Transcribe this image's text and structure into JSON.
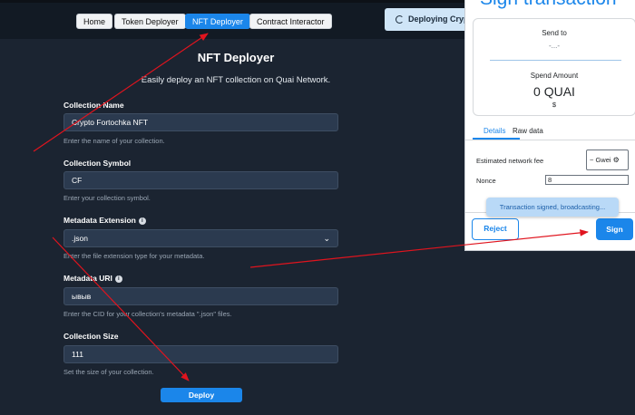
{
  "nav": {
    "home": "Home",
    "token_deployer": "Token Deployer",
    "nft_deployer": "NFT Deployer",
    "contract_interactor": "Contract Interactor",
    "deploying": "Deploying Crypt"
  },
  "page": {
    "title": "NFT Deployer",
    "subtitle": "Easily deploy an NFT collection on Quai Network."
  },
  "form": {
    "collection_name": {
      "label": "Collection Name",
      "value": "Crypto Fortochka NFT",
      "help": "Enter the name of your collection."
    },
    "collection_symbol": {
      "label": "Collection Symbol",
      "value": "CF",
      "help": "Enter your collection symbol."
    },
    "metadata_extension": {
      "label": "Metadata Extension",
      "value": ".json",
      "help": "Enter the file extension type for your metadata."
    },
    "metadata_uri": {
      "label": "Metadata URI",
      "value": "ывыв",
      "help": "Enter the CID for your collection's metadata \".json\" files."
    },
    "collection_size": {
      "label": "Collection Size",
      "value": "111",
      "help": "Set the size of your collection."
    },
    "deploy_label": "Deploy"
  },
  "wallet": {
    "title": "Sign transaction",
    "send_to_label": "Send to",
    "send_to_value": "-...-",
    "spend_amount_label": "Spend Amount",
    "spend_amount_value": "0 QUAI",
    "spend_amount_usd": "$",
    "tabs": {
      "details": "Details",
      "raw_data": "Raw data"
    },
    "fee_label": "Estimated network fee",
    "fee_unit": "~ Gwei",
    "nonce_label": "Nonce",
    "nonce_value": "8",
    "toast": "Transaction signed, broadcasting...",
    "reject_label": "Reject",
    "sign_label": "Sign"
  },
  "colors": {
    "background": "#1b2431",
    "accent": "#1b86ea",
    "annotation_arrow": "#e0141e"
  },
  "icons": [
    "info-icon",
    "chevron-down-icon",
    "gear-icon",
    "spinner-icon"
  ]
}
